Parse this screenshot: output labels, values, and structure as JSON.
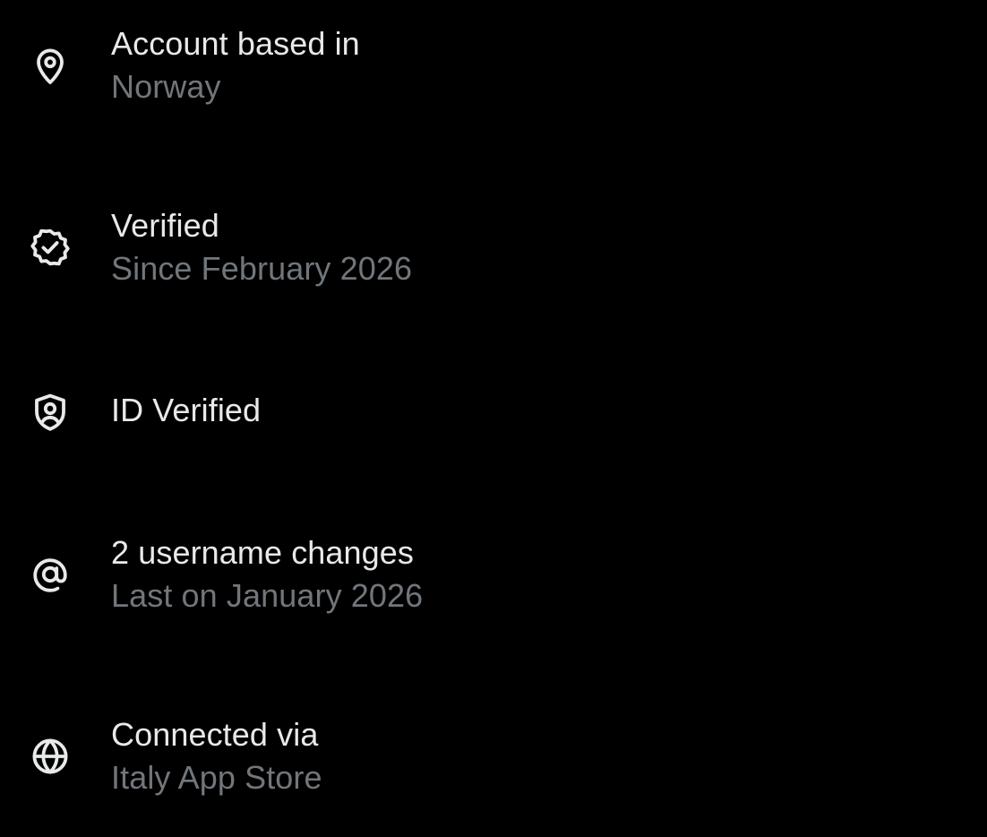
{
  "about": {
    "items": [
      {
        "icon": "location-pin-icon",
        "title": "Account based in",
        "subtitle": "Norway"
      },
      {
        "icon": "verified-badge-icon",
        "title": "Verified",
        "subtitle": "Since February 2026"
      },
      {
        "icon": "id-shield-icon",
        "title": "ID Verified"
      },
      {
        "icon": "at-sign-icon",
        "title": "2 username changes",
        "subtitle": "Last on January 2026"
      },
      {
        "icon": "globe-icon",
        "title": "Connected via",
        "subtitle": "Italy App Store"
      }
    ]
  },
  "colors": {
    "background": "#000000",
    "primary_text": "#e7e9ea",
    "secondary_text": "#71767b",
    "icon": "#e7e9ea"
  }
}
